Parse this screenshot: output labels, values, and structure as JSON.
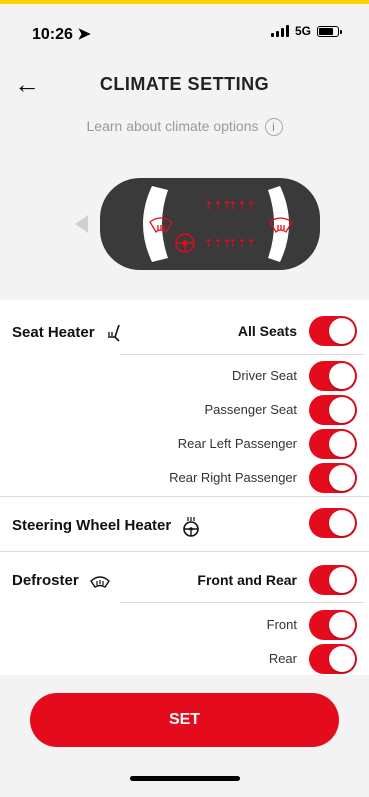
{
  "status": {
    "time": "10:26",
    "network": "5G"
  },
  "header": {
    "title": "CLIMATE SETTING",
    "learn_text": "Learn about climate options",
    "info_glyph": "i"
  },
  "sections": {
    "seat_heater": {
      "label": "Seat Heater",
      "all_label": "All Seats",
      "subs": [
        "Driver Seat",
        "Passenger Seat",
        "Rear Left Passenger",
        "Rear Right Passenger"
      ]
    },
    "steering": {
      "label": "Steering Wheel Heater"
    },
    "defroster": {
      "label": "Defroster",
      "both_label": "Front and Rear",
      "subs": [
        "Front",
        "Rear"
      ]
    }
  },
  "toggles_on": true,
  "set_button": "SET",
  "colors": {
    "accent": "#e30b1c",
    "background": "#f3f3f3"
  }
}
